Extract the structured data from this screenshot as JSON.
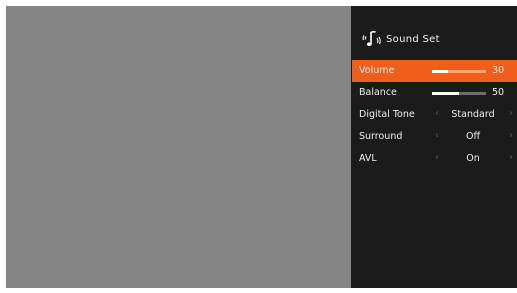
{
  "panel": {
    "title": "Sound Set",
    "icon": "sound-icon"
  },
  "menu": {
    "volume": {
      "label": "Volume",
      "value": "30",
      "level": 0.3,
      "selected": true
    },
    "balance": {
      "label": "Balance",
      "value": "50",
      "level": 0.5
    },
    "digital_tone": {
      "label": "Digital Tone",
      "value": "Standard"
    },
    "surround": {
      "label": "Surround",
      "value": "Off"
    },
    "avl": {
      "label": "AVL",
      "value": "On"
    }
  },
  "arrows": {
    "left": "‹",
    "right": "›"
  },
  "colors": {
    "accent": "#f05e1c",
    "panel_bg": "#1b1b1b",
    "video_bg": "#858585"
  }
}
